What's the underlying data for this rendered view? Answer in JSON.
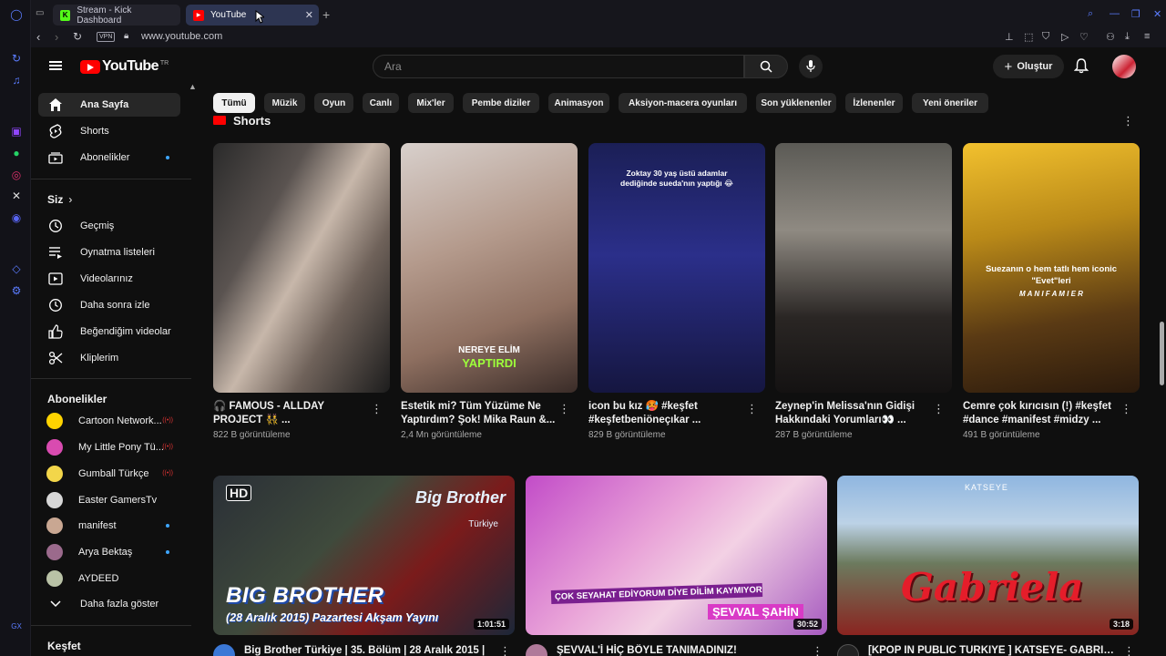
{
  "browser": {
    "tabs": [
      {
        "label": "Stream - Kick Dashboard"
      },
      {
        "label": "YouTube"
      }
    ],
    "url": "www.youtube.com",
    "vpn_label": "VPN"
  },
  "masthead": {
    "logo_text": "YouTube",
    "country_code": "TR",
    "search_placeholder": "Ara",
    "create_label": "Oluştur"
  },
  "sidebar": {
    "main": [
      {
        "label": "Ana Sayfa",
        "icon": "home-icon"
      },
      {
        "label": "Shorts",
        "icon": "shorts-icon"
      },
      {
        "label": "Abonelikler",
        "icon": "subscriptions-icon"
      }
    ],
    "you_header": "Siz",
    "you_items": [
      {
        "label": "Geçmiş",
        "icon": "history-icon"
      },
      {
        "label": "Oynatma listeleri",
        "icon": "playlist-icon"
      },
      {
        "label": "Videolarınız",
        "icon": "your-videos-icon"
      },
      {
        "label": "Daha sonra izle",
        "icon": "watch-later-icon"
      },
      {
        "label": "Beğendiğim videolar",
        "icon": "liked-icon"
      },
      {
        "label": "Kliplerim",
        "icon": "clips-icon"
      }
    ],
    "subs_header": "Abonelikler",
    "subscriptions": [
      {
        "label": "Cartoon Network...",
        "color": "#ffd400"
      },
      {
        "label": "My Little Pony Tü...",
        "color": "#d94bb0"
      },
      {
        "label": "Gumball Türkçe",
        "color": "#f3d64a"
      },
      {
        "label": "Easter GamersTv",
        "color": "#d7d7d7"
      },
      {
        "label": "manifest",
        "color": "#c9a792"
      },
      {
        "label": "Arya Bektaş",
        "color": "#9b6a8c"
      },
      {
        "label": "AYDEED",
        "color": "#b9c2a6"
      }
    ],
    "show_more": "Daha fazla göster",
    "explore_header": "Keşfet"
  },
  "chips": [
    "Tümü",
    "Müzik",
    "Oyun",
    "Canlı",
    "Mix'ler",
    "Pembe diziler",
    "Animasyon",
    "Aksiyon-macera oyunları",
    "Son yüklenenler",
    "İzlenenler",
    "Yeni öneriler"
  ],
  "shorts": {
    "header": "Shorts",
    "items": [
      {
        "title": "🎧 FAMOUS - ALLDAY PROJECT 👯 ...",
        "views": "822 B görüntüleme"
      },
      {
        "title": "Estetik mi? Tüm Yüzüme Ne Yaptırdım? Şok! Mika Raun &...",
        "views": "2,4 Mn görüntüleme",
        "overlay1": "NEREYE ELİM",
        "overlay2": "YAPTIRDI"
      },
      {
        "title": "icon bu kız 🥵 #keşfet #keşfetbeniöneçıkar ...",
        "views": "829 B görüntüleme",
        "overlay": "Zoktay 30 yaş üstü adamlar dediğinde sueda'nın yaptığı 😂"
      },
      {
        "title": "Zeynep'in Melissa'nın Gidişi Hakkındaki Yorumları👀 ...",
        "views": "287 B görüntüleme"
      },
      {
        "title": "Cemre çok kırıcısın (!) #keşfet #dance #manifest #midzy ...",
        "views": "491 B görüntüleme",
        "overlay1": "Suezanın o hem tatlı hem iconic",
        "overlay2": "\"Evet\"leri",
        "overlay3": "M A N I F A M I E R"
      }
    ]
  },
  "videos": [
    {
      "title": "Big Brother Türkiye | 35. Bölüm | 28 Aralık 2015 |",
      "duration": "1:01:51",
      "badge": "HD",
      "thumb_line1": "BIG BROTHER",
      "thumb_line2": "(28 Aralık 2015) Pazartesi Akşam Yayını",
      "brand": "Big Brother",
      "brand_sub": "Türkiye"
    },
    {
      "title": "ŞEVVAL'İ HİÇ BÖYLE TANIMADINIZ!",
      "duration": "30:52",
      "thumb_line1": "ÇOK SEYAHAT EDİYORUM DİYE DİLİM KAYMIYOR",
      "thumb_line2": "ŞEVVAL ŞAHİN"
    },
    {
      "title": "[KPOP IN PUBLIC TURKIYE ] KATSEYE- GABRIELA",
      "duration": "3:18",
      "thumb_line1": "Gabriela",
      "brand": "KATSEYE"
    }
  ]
}
